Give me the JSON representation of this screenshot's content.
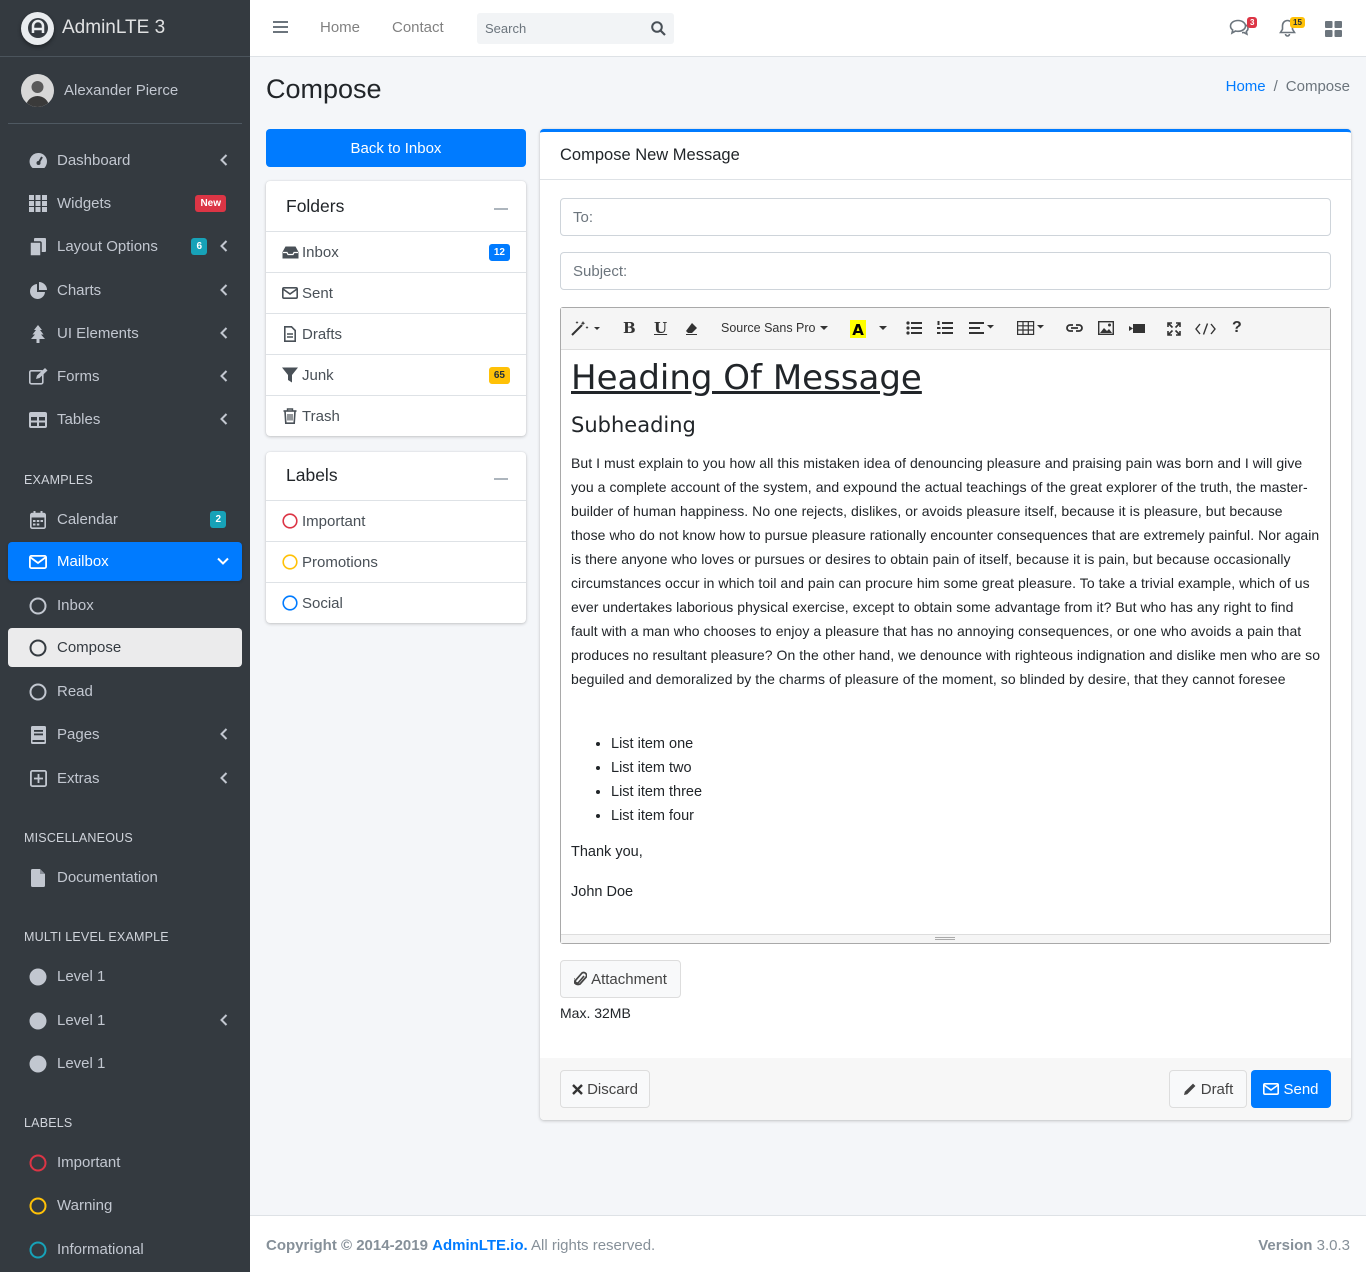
{
  "brand": {
    "name": "AdminLTE 3"
  },
  "user": {
    "name": "Alexander Pierce"
  },
  "sidebar": {
    "items": [
      {
        "label": "Dashboard"
      },
      {
        "label": "Widgets",
        "badge": "New"
      },
      {
        "label": "Layout Options",
        "badge": "6"
      },
      {
        "label": "Charts"
      },
      {
        "label": "UI Elements"
      },
      {
        "label": "Forms"
      },
      {
        "label": "Tables"
      }
    ],
    "examples_header": "EXAMPLES",
    "examples": [
      {
        "label": "Calendar",
        "badge": "2"
      },
      {
        "label": "Mailbox"
      },
      {
        "label": "Inbox"
      },
      {
        "label": "Compose"
      },
      {
        "label": "Read"
      },
      {
        "label": "Pages"
      },
      {
        "label": "Extras"
      }
    ],
    "misc_header": "MISCELLANEOUS",
    "misc": [
      {
        "label": "Documentation"
      }
    ],
    "multi_header": "MULTI LEVEL EXAMPLE",
    "multi": [
      {
        "label": "Level 1"
      },
      {
        "label": "Level 1"
      },
      {
        "label": "Level 1"
      }
    ],
    "labels_header": "LABELS",
    "labels": [
      {
        "label": "Important",
        "color": "#dc3545"
      },
      {
        "label": "Warning",
        "color": "#ffc107"
      },
      {
        "label": "Informational",
        "color": "#17a2b8"
      }
    ]
  },
  "topbar": {
    "home": "Home",
    "contact": "Contact",
    "search_placeholder": "Search",
    "messages_count": "3",
    "notifications_count": "15"
  },
  "page": {
    "title": "Compose",
    "breadcrumb_home": "Home",
    "breadcrumb_current": "Compose"
  },
  "folders": {
    "back_button": "Back to Inbox",
    "title": "Folders",
    "items": [
      {
        "label": "Inbox",
        "badge": "12"
      },
      {
        "label": "Sent"
      },
      {
        "label": "Drafts"
      },
      {
        "label": "Junk",
        "badge": "65"
      },
      {
        "label": "Trash"
      }
    ]
  },
  "labels_card": {
    "title": "Labels",
    "items": [
      {
        "label": "Important",
        "color": "#dc3545"
      },
      {
        "label": "Promotions",
        "color": "#ffc107"
      },
      {
        "label": "Social",
        "color": "#007bff"
      }
    ]
  },
  "compose": {
    "title": "Compose New Message",
    "to_placeholder": "To:",
    "subject_placeholder": "Subject:",
    "font_name": "Source Sans Pro",
    "heading": "Heading Of Message",
    "subheading": "Subheading",
    "paragraph": "But I must explain to you how all this mistaken idea of denouncing pleasure and praising pain was born and I will give you a complete account of the system, and expound the actual teachings of the great explorer of the truth, the master-builder of human happiness. No one rejects, dislikes, or avoids pleasure itself, because it is pleasure, but because those who do not know how to pursue pleasure rationally encounter consequences that are extremely painful. Nor again is there anyone who loves or pursues or desires to obtain pain of itself, because it is pain, but because occasionally circumstances occur in which toil and pain can procure him some great pleasure. To take a trivial example, which of us ever undertakes laborious physical exercise, except to obtain some advantage from it? But who has any right to find fault with a man who chooses to enjoy a pleasure that has no annoying consequences, or one who avoids a pain that produces no resultant pleasure? On the other hand, we denounce with righteous indignation and dislike men who are so beguiled and demoralized by the charms of pleasure of the moment, so blinded by desire, that they cannot foresee",
    "list": [
      "List item one",
      "List item two",
      "List item three",
      "List item four"
    ],
    "thanks": "Thank you,",
    "signature": "John Doe",
    "attachment_label": "Attachment",
    "max_size": "Max. 32MB",
    "discard_label": "Discard",
    "draft_label": "Draft",
    "send_label": "Send"
  },
  "footer": {
    "copyright": "Copyright © 2014-2019",
    "link": "AdminLTE.io.",
    "rights": "All rights reserved.",
    "version_label": "Version",
    "version": "3.0.3"
  }
}
